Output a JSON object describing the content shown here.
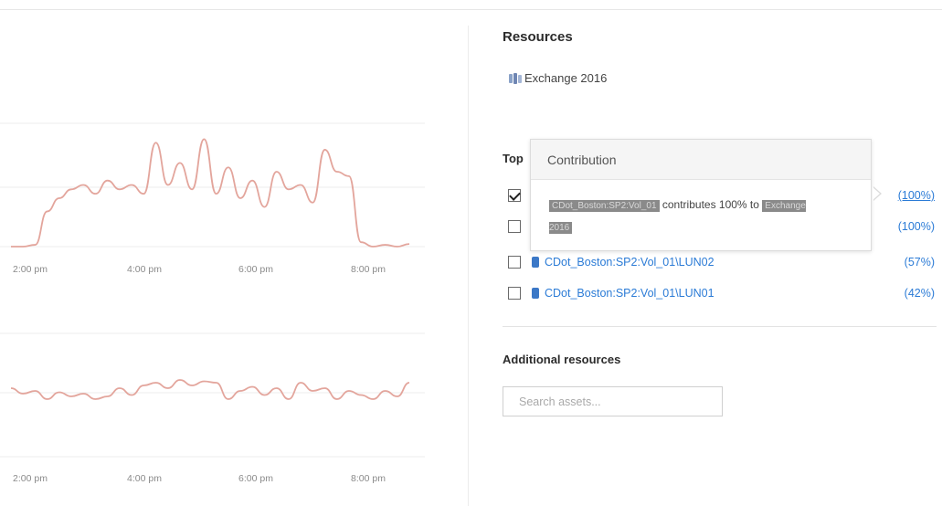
{
  "resources": {
    "title": "Resources",
    "item": {
      "label": "Exchange 2016",
      "icon": "application-icon"
    }
  },
  "top": {
    "label": "Top",
    "rows": [
      {
        "checked": true,
        "volume": "",
        "percent": "(100%)",
        "underlined": true
      },
      {
        "checked": false,
        "volume": "",
        "percent": "(100%)",
        "underlined": false
      },
      {
        "checked": false,
        "volume": "CDot_Boston:SP2:Vol_01\\LUN02",
        "percent": "(57%)",
        "underlined": false
      },
      {
        "checked": false,
        "volume": "CDot_Boston:SP2:Vol_01\\LUN01",
        "percent": "(42%)",
        "underlined": false
      }
    ]
  },
  "tooltip": {
    "title": "Contribution",
    "subject": "CDot_Boston:SP2:Vol_01",
    "text": "contributes 100% to",
    "target": "Exchange 2016"
  },
  "additional": {
    "label": "Additional resources",
    "search_placeholder": "Search assets..."
  },
  "colors": {
    "series": "#e3a59c",
    "link": "#2b7bd6",
    "volume_icon": "#3b78c7"
  },
  "chart_data": [
    {
      "type": "line",
      "x": [
        "1:00 pm",
        "1:15 pm",
        "1:30 pm",
        "1:45 pm",
        "2:00 pm",
        "2:15 pm",
        "2:30 pm",
        "2:45 pm",
        "3:00 pm",
        "3:15 pm",
        "3:30 pm",
        "3:45 pm",
        "4:00 pm",
        "4:15 pm",
        "4:30 pm",
        "4:45 pm",
        "5:00 pm",
        "5:15 pm",
        "5:30 pm",
        "5:45 pm",
        "6:00 pm",
        "6:15 pm",
        "6:30 pm",
        "6:45 pm",
        "7:00 pm",
        "7:15 pm",
        "7:30 pm",
        "7:45 pm",
        "8:00 pm",
        "8:15 pm",
        "8:30 pm",
        "8:45 pm",
        "9:00 pm",
        "9:15 pm"
      ],
      "xticks": [
        "2:00 pm",
        "4:00 pm",
        "6:00 pm",
        "8:00 pm"
      ],
      "values": [
        0,
        0,
        2,
        40,
        55,
        65,
        70,
        60,
        75,
        65,
        70,
        60,
        118,
        70,
        95,
        65,
        122,
        60,
        90,
        55,
        75,
        45,
        85,
        65,
        70,
        50,
        110,
        85,
        80,
        5,
        0,
        2,
        0,
        3
      ],
      "ylim": [
        0,
        140
      ]
    },
    {
      "type": "line",
      "x": [
        "1:00 pm",
        "1:15 pm",
        "1:30 pm",
        "1:45 pm",
        "2:00 pm",
        "2:15 pm",
        "2:30 pm",
        "2:45 pm",
        "3:00 pm",
        "3:15 pm",
        "3:30 pm",
        "3:45 pm",
        "4:00 pm",
        "4:15 pm",
        "4:30 pm",
        "4:45 pm",
        "5:00 pm",
        "5:15 pm",
        "5:30 pm",
        "5:45 pm",
        "6:00 pm",
        "6:15 pm",
        "6:30 pm",
        "6:45 pm",
        "7:00 pm",
        "7:15 pm",
        "7:30 pm",
        "7:45 pm",
        "8:00 pm",
        "8:15 pm",
        "8:30 pm",
        "8:45 pm",
        "9:00 pm",
        "9:15 pm"
      ],
      "xticks": [
        "2:00 pm",
        "4:00 pm",
        "6:00 pm",
        "8:00 pm"
      ],
      "values": [
        20,
        16,
        18,
        12,
        17,
        14,
        16,
        12,
        14,
        20,
        15,
        22,
        24,
        20,
        26,
        22,
        25,
        24,
        12,
        18,
        21,
        15,
        20,
        12,
        24,
        18,
        20,
        12,
        18,
        15,
        12,
        18,
        14,
        24
      ],
      "ylim": [
        0,
        60
      ]
    }
  ]
}
